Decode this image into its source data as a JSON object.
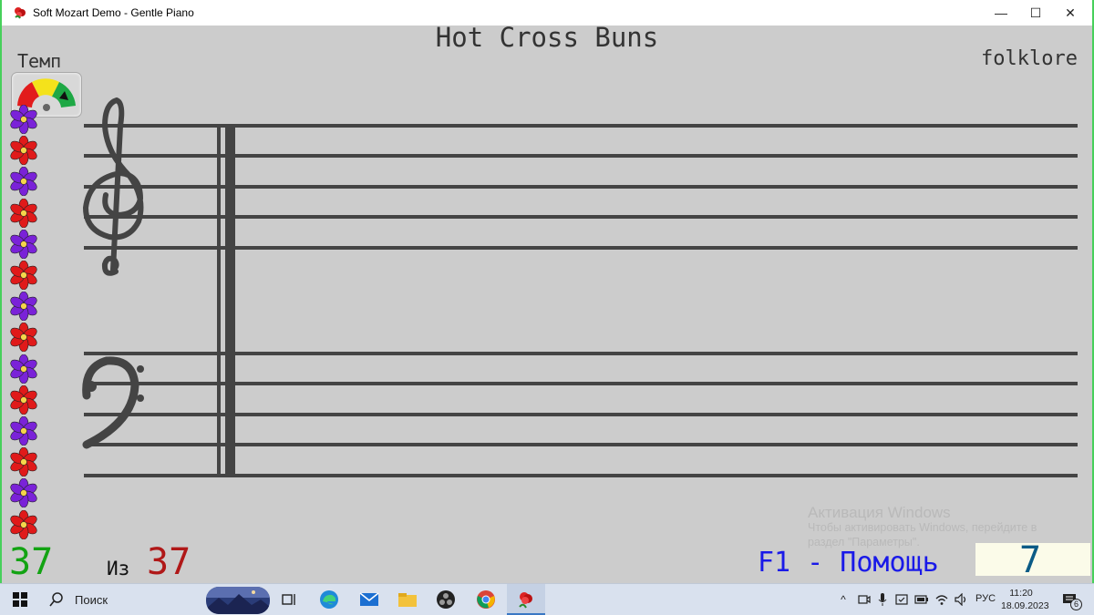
{
  "window": {
    "title": "Soft Mozart Demo - Gentle Piano",
    "minimize": "—",
    "maximize": "☐",
    "close": "✕"
  },
  "song": {
    "title": "Hot Cross Buns",
    "composer": "folklore"
  },
  "tempo": {
    "label": "Темп"
  },
  "counter": {
    "current": "37",
    "of_label": "Из",
    "total": "37"
  },
  "help": {
    "label": "F1 - Помощь"
  },
  "score": {
    "value": "7"
  },
  "activation": {
    "line1": "Активация Windows",
    "line2": "Чтобы активировать Windows, перейдите в",
    "line3": "раздел \"Параметры\"."
  },
  "taskbar": {
    "search_label": "Поиск",
    "language": "РУС",
    "time": "11:20",
    "date": "18.09.2023",
    "notification_count": "6"
  },
  "colors": {
    "flower_purple": "#7a22d8",
    "flower_red": "#e01a1a",
    "counter_green": "#13a313",
    "counter_red": "#b01818",
    "help_blue": "#1a1ae8",
    "score_blue": "#0b5b86"
  }
}
